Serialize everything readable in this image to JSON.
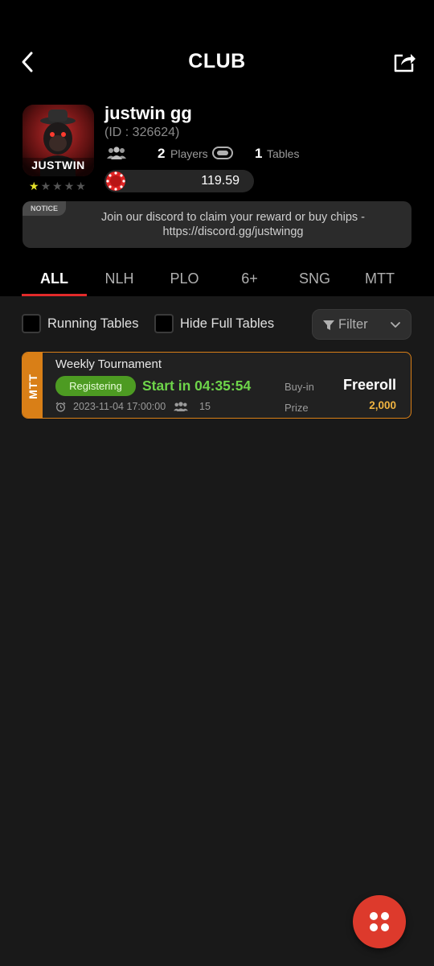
{
  "header": {
    "title": "CLUB"
  },
  "club": {
    "name": "justwin gg",
    "id_text": "(ID : 326624)",
    "logo_text": "JUSTWIN",
    "rating": 1,
    "rating_max": 5,
    "players_count": "2",
    "players_label": "Players",
    "tables_count": "1",
    "tables_label": "Tables",
    "chips_balance": "119.59"
  },
  "notice": {
    "tag": "NOTICE",
    "text": "Join our discord to claim your reward or buy chips - https://discord.gg/justwingg"
  },
  "tabs": [
    {
      "label": "ALL",
      "active": true
    },
    {
      "label": "NLH",
      "active": false
    },
    {
      "label": "PLO",
      "active": false
    },
    {
      "label": "6+",
      "active": false
    },
    {
      "label": "SNG",
      "active": false
    },
    {
      "label": "MTT",
      "active": false
    }
  ],
  "filters": {
    "running_tables_label": "Running Tables",
    "hide_full_label": "Hide Full Tables",
    "filter_label": "Filter"
  },
  "tournaments": [
    {
      "type": "MTT",
      "name": "Weekly Tournament",
      "status": "Registering",
      "countdown": "Start in 04:35:54",
      "datetime": "2023-11-04 17:00:00",
      "players": "15",
      "buyin_label": "Buy-in",
      "buyin_value": "Freeroll",
      "prize_label": "Prize",
      "prize_value": "2,000"
    }
  ],
  "colors": {
    "accent_red": "#e22a2a",
    "mtt_orange": "#d97f17",
    "registering_green": "#4d9b22",
    "countdown_green": "#6ed54a",
    "prize_gold": "#f0b441"
  }
}
